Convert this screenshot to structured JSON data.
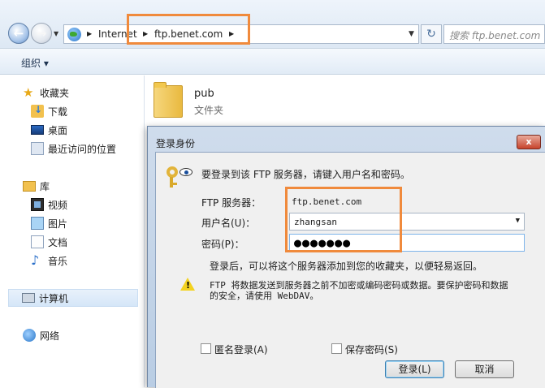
{
  "address_bar": {
    "crumbs": [
      "Internet",
      "ftp.benet.com"
    ],
    "search_placeholder": "搜索 ftp.benet.com",
    "refresh_glyph": "↻"
  },
  "toolbar": {
    "organize_label": "组织 ▾"
  },
  "sidebar": {
    "favorites": {
      "label": "收藏夹",
      "items": [
        "下载",
        "桌面",
        "最近访问的位置"
      ]
    },
    "libraries": {
      "label": "库",
      "items": [
        "视频",
        "图片",
        "文档",
        "音乐"
      ]
    },
    "computer": {
      "label": "计算机"
    },
    "network": {
      "label": "网络"
    }
  },
  "folder": {
    "name": "pub",
    "type": "文件夹"
  },
  "dialog": {
    "title": "登录身份",
    "close_glyph": "x",
    "prompt": "要登录到该 FTP 服务器，请键入用户名和密码。",
    "server_label": "FTP 服务器：",
    "server_value": "ftp.benet.com",
    "username_label": "用户名(U)：",
    "username_value": "zhangsan",
    "password_label": "密码(P)：",
    "password_mask": "●●●●●●●",
    "favorites_hint": "登录后，可以将这个服务器添加到您的收藏夹，以便轻易返回。",
    "warning_line1": "FTP 将数据发送到服务器之前不加密或编码密码或数据。要保护密码和数据",
    "warning_line2": "的安全，请使用 WebDAV。",
    "anonymous_label": "匿名登录(A)",
    "save_password_label": "保存密码(S)",
    "login_button": "登录(L)",
    "cancel_button": "取消"
  },
  "colors": {
    "highlight": "#f08a3c",
    "dialog_frame": "#b9cde4",
    "dialog_body": "#f0f0f0"
  }
}
